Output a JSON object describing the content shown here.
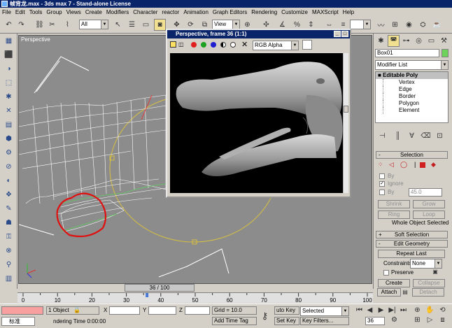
{
  "window": {
    "title": "帧背龙.max - 3ds max 7 - Stand-alone License"
  },
  "menu": [
    "File",
    "Edit",
    "Tools",
    "Group",
    "Views",
    "Create",
    "Modifiers",
    "Character",
    "reactor",
    "Animation",
    "Graph Editors",
    "Rendering",
    "Customize",
    "MAXScript",
    "Help"
  ],
  "toolbar": {
    "selection_filter": "All",
    "ref_coord": "View",
    "icons": [
      "undo-icon",
      "redo-icon",
      "link-icon",
      "unlink-icon",
      "bind-space-warp-icon",
      "select-icon",
      "select-by-name-icon",
      "region-select-icon",
      "window-crossing-icon",
      "move-icon",
      "rotate-icon",
      "scale-icon",
      "pivot-icon",
      "snap-icon",
      "angle-snap-icon",
      "percent-snap-icon",
      "spinner-snap-icon",
      "mirror-icon",
      "align-icon",
      "curve-editor-icon",
      "schematic-icon",
      "material-editor-icon",
      "render-scene-icon",
      "quick-render-icon"
    ]
  },
  "viewport": {
    "label": "Perspective"
  },
  "render_window": {
    "title": "Perspective, frame 36 (1:1)",
    "channel": "RGB Alpha"
  },
  "command_panel": {
    "object_name": "Box01",
    "object_color": "#6ed35a",
    "modifier_list": "Modifier List",
    "stack": {
      "title": "Editable Poly",
      "items": [
        "Vertex",
        "Edge",
        "Border",
        "Polygon",
        "Element"
      ]
    },
    "selection": {
      "title": "Selection",
      "by_vertex": "By",
      "ignore_backfacing": "Ignore",
      "by_angle": "By",
      "angle_value": "45.0",
      "shrink": "Shrink",
      "grow": "Grow",
      "ring": "Ring",
      "loop": "Loop",
      "status": "Whole Object Selected"
    },
    "soft_selection": {
      "title": "Soft Selection"
    },
    "edit_geometry": {
      "title": "Edit Geometry",
      "repeat_last": "Repeat Last",
      "constraints_label": "Constraints:",
      "constraints_value": "None",
      "preserve": "Preserve",
      "create": "Create",
      "collapse": "Collapse",
      "attach": "Attach",
      "detach": "Detach"
    }
  },
  "timeline": {
    "frame_label": "36 / 100",
    "current_frame": 36,
    "total_frames": 100,
    "ticks": [
      "0",
      "10",
      "20",
      "30",
      "40",
      "50",
      "60",
      "70",
      "80",
      "90",
      "100"
    ]
  },
  "statusbar": {
    "selection_count": "1 Object",
    "x_label": "X",
    "y_label": "Y",
    "z_label": "Z",
    "grid": "Grid = 10.0",
    "auto_key": "uto Key",
    "selected": "Selected",
    "set_key": "Set Key",
    "key_filters": "Key Filters...",
    "add_time_tag": "Add Time Tag",
    "status_text": "ndering Time  0:00:00",
    "ime_label": "标准",
    "frame": "36"
  }
}
